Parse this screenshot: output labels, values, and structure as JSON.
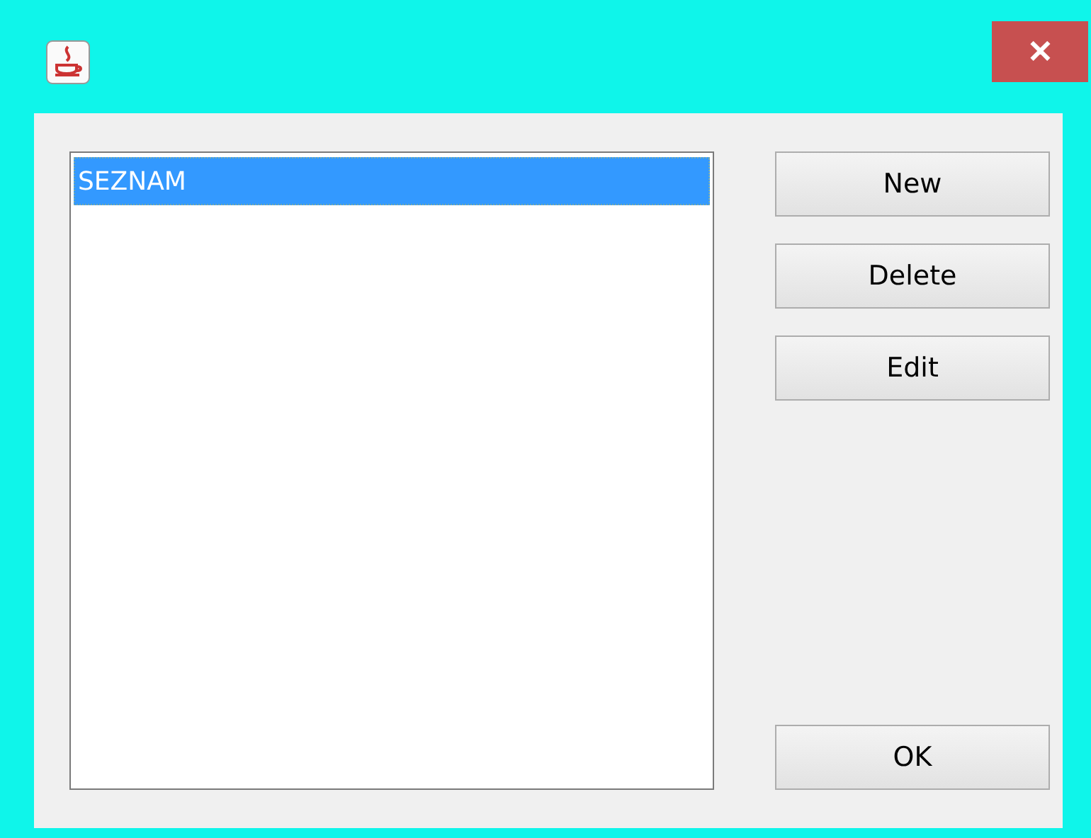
{
  "window": {
    "close": "✕"
  },
  "list": {
    "items": [
      {
        "label": "SEZNAM",
        "selected": true
      }
    ]
  },
  "buttons": [
    {
      "label": "New",
      "kind": "top"
    },
    {
      "label": "Delete",
      "kind": "top"
    },
    {
      "label": "Edit",
      "kind": "top"
    },
    {
      "label": "OK",
      "kind": "bottom"
    }
  ]
}
